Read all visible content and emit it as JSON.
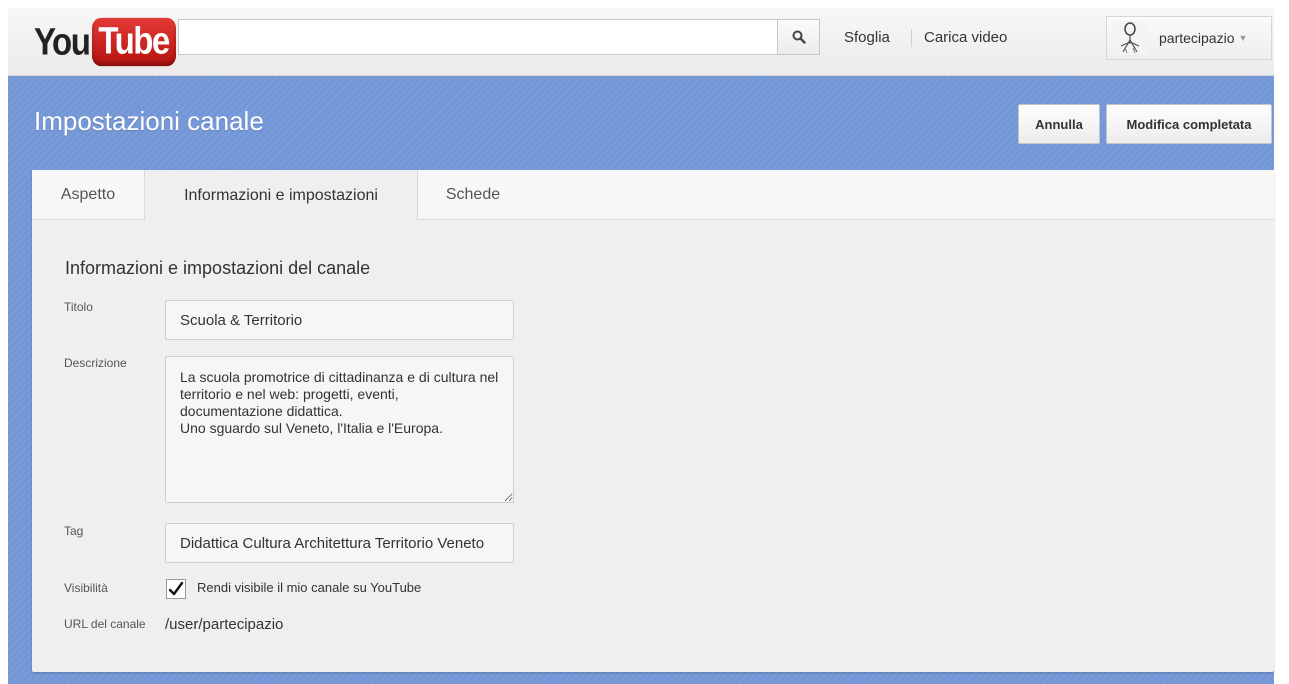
{
  "masthead": {
    "logo_you": "You",
    "logo_tube": "Tube",
    "search_value": "",
    "search_icon": "search-icon",
    "nav": {
      "browse": "Sfoglia",
      "upload": "Carica video"
    },
    "user": {
      "name": "partecipazio",
      "avatar_icon": "avatar-icon",
      "caret_icon": "caret-down-icon"
    }
  },
  "header": {
    "title": "Impostazioni canale",
    "cancel_label": "Annulla",
    "done_label": "Modifica completata",
    "band_color": "#7396d6"
  },
  "tabs": [
    {
      "label": "Aspetto",
      "active": false
    },
    {
      "label": "Informazioni e impostazioni",
      "active": true
    },
    {
      "label": "Schede",
      "active": false
    }
  ],
  "form": {
    "section_title": "Informazioni e impostazioni del canale",
    "title_label": "Titolo",
    "title_value": "Scuola & Territorio",
    "description_label": "Descrizione",
    "description_value": "La scuola promotrice di cittadinanza e di cultura nel territorio e nel web: progetti, eventi, documentazione didattica.\nUno sguardo sul Veneto, l'Italia e l'Europa.",
    "tag_label": "Tag",
    "tag_value": "Didattica Cultura Architettura Territorio Veneto",
    "visibility_label": "Visibilità",
    "visibility_checked": true,
    "visibility_text": "Rendi visibile il mio canale su YouTube",
    "url_label": "URL del canale",
    "url_value": "/user/partecipazio"
  }
}
